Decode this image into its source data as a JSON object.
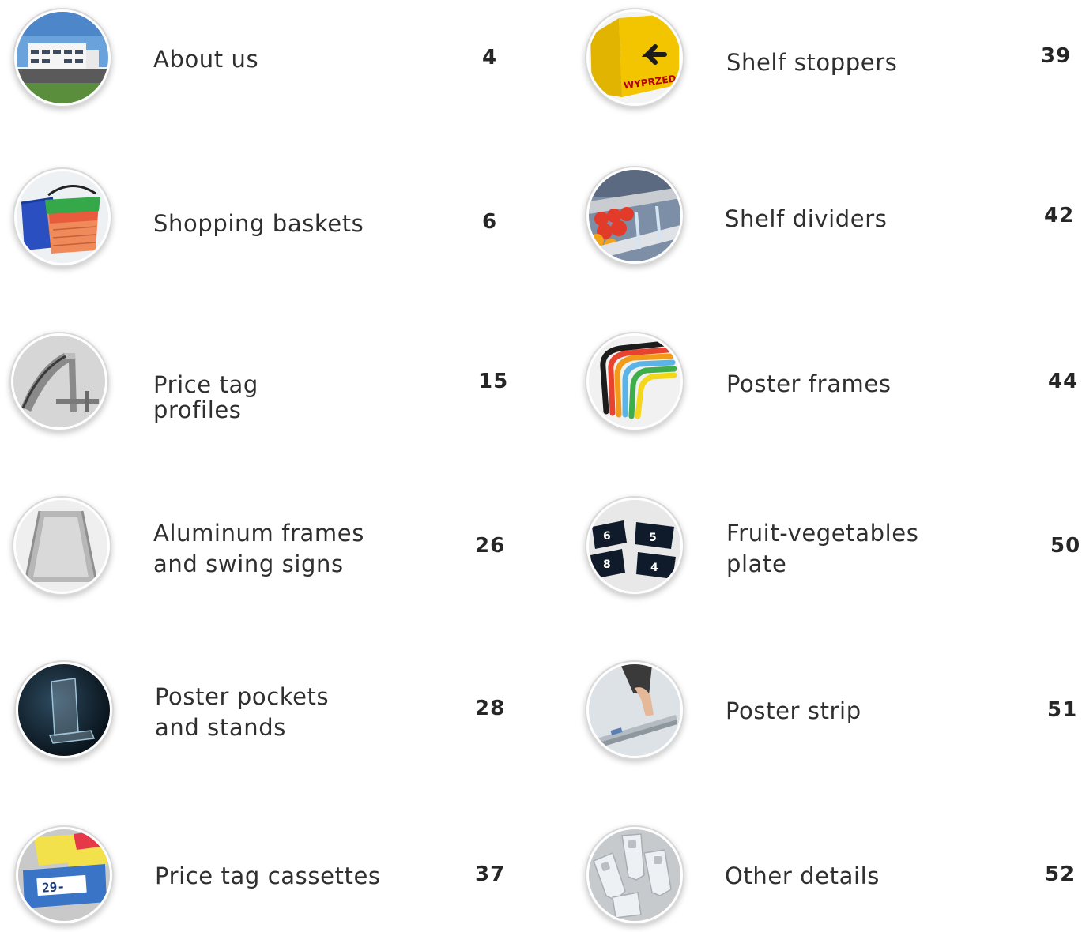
{
  "left_column": [
    {
      "title_lines": [
        "About us"
      ],
      "page": "4",
      "icon": "building-photo-icon"
    },
    {
      "title_lines": [
        "Shopping baskets"
      ],
      "page": "6",
      "icon": "shopping-baskets-photo-icon"
    },
    {
      "title_lines": [
        "Price tag",
        "profiles"
      ],
      "page": "15",
      "icon": "price-tag-profile-photo-icon"
    },
    {
      "title_lines": [
        "Aluminum frames",
        "and swing signs"
      ],
      "page": "26",
      "icon": "swing-sign-photo-icon"
    },
    {
      "title_lines": [
        "Poster pockets",
        "and stands"
      ],
      "page": "28",
      "icon": "poster-stand-photo-icon"
    },
    {
      "title_lines": [
        "Price tag cassettes"
      ],
      "page": "37",
      "icon": "price-tag-cassette-photo-icon"
    }
  ],
  "right_column": [
    {
      "title_lines": [
        "Shelf stoppers"
      ],
      "page": "39",
      "icon": "shelf-stopper-photo-icon",
      "image_text": "WYPRZEDAŻ"
    },
    {
      "title_lines": [
        "Shelf dividers"
      ],
      "page": "42",
      "icon": "shelf-divider-photo-icon"
    },
    {
      "title_lines": [
        "Poster frames"
      ],
      "page": "44",
      "icon": "poster-frames-photo-icon"
    },
    {
      "title_lines": [
        "Fruit-vegetables",
        "plate"
      ],
      "page": "50",
      "icon": "fruit-vegetable-plate-photo-icon"
    },
    {
      "title_lines": [
        "Poster strip"
      ],
      "page": "51",
      "icon": "poster-strip-photo-icon"
    },
    {
      "title_lines": [
        "Other details"
      ],
      "page": "52",
      "icon": "other-details-photo-icon"
    }
  ],
  "colors": {
    "text": "#2f2f2f",
    "page_number": "#262626",
    "thumb_ring": "#d9d9d9",
    "sign_yellow": "#f2c500",
    "basket_blue": "#2a4fc0",
    "basket_green": "#35a84a",
    "basket_orange": "#f08a5a"
  }
}
